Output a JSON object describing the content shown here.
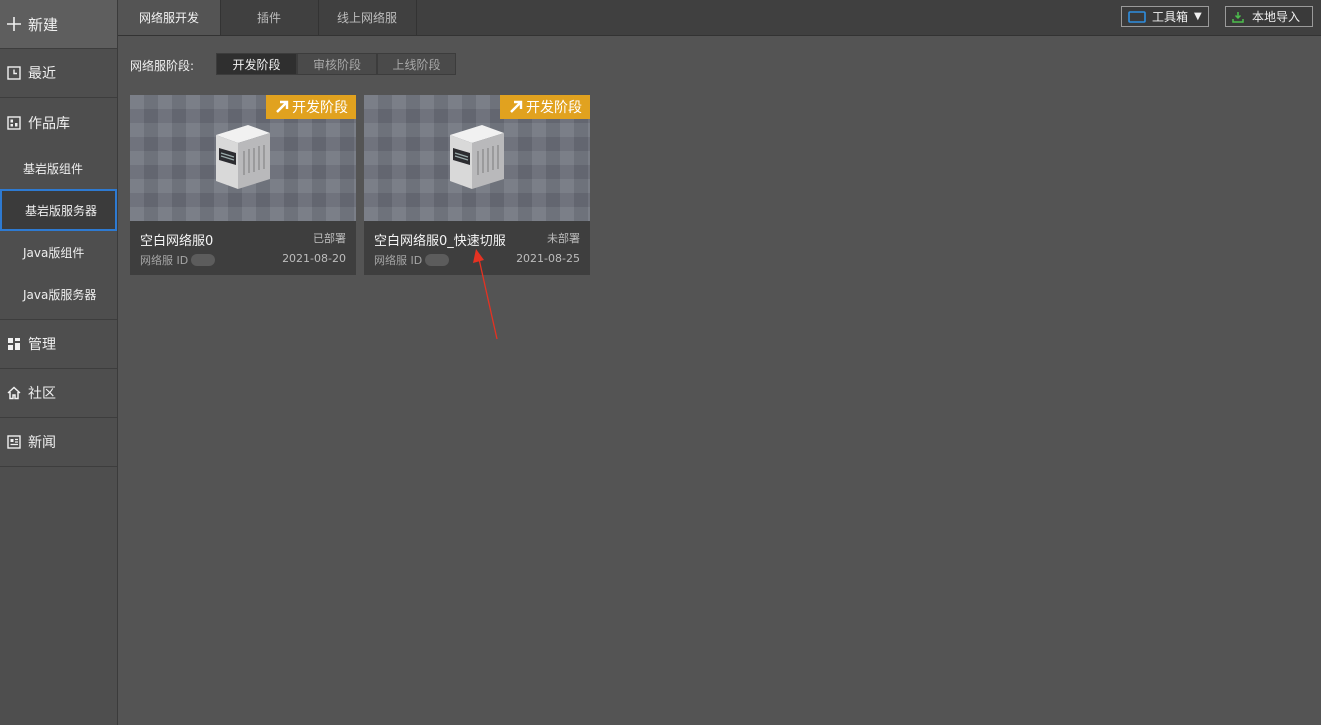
{
  "sidebar": {
    "new_label": "新建",
    "recent_label": "最近",
    "library_label": "作品库",
    "library_items": [
      "基岩版组件",
      "基岩版服务器",
      "Java版组件",
      "Java版服务器"
    ],
    "manage_label": "管理",
    "community_label": "社区",
    "news_label": "新闻"
  },
  "tabs": [
    "网络服开发",
    "插件",
    "线上网络服"
  ],
  "toolbar": {
    "toolbox_label": "工具箱",
    "import_label": "本地导入"
  },
  "stage": {
    "label": "网络服阶段:",
    "options": [
      "开发阶段",
      "审核阶段",
      "上线阶段"
    ],
    "selected": "开发阶段"
  },
  "cards": [
    {
      "badge": "开发阶段",
      "name": "空白网络服0",
      "status": "已部署",
      "id_label": "网络服 ID",
      "date": "2021-08-20"
    },
    {
      "badge": "开发阶段",
      "name": "空白网络服0_快速切服",
      "status": "未部署",
      "id_label": "网络服 ID",
      "date": "2021-08-25"
    }
  ],
  "colors": {
    "accent_blue": "#2e7ad1",
    "badge": "#e1a21f",
    "annotation": "#e53222"
  }
}
